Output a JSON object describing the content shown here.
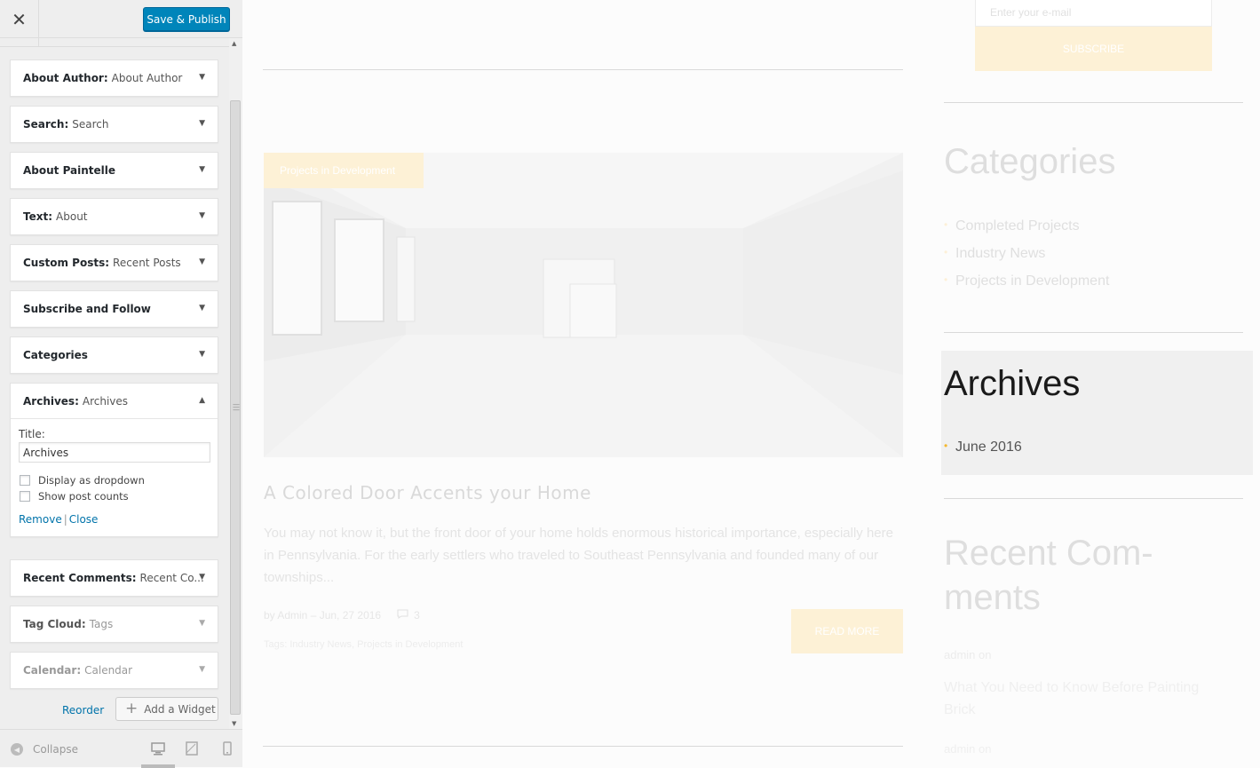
{
  "header": {
    "close_glyph": "✕",
    "save_publish_label": "Save & Publish"
  },
  "widgets": [
    {
      "name": "About Author",
      "sub": "About Author"
    },
    {
      "name": "Search",
      "sub": "Search"
    },
    {
      "name": "About Paintelle",
      "sub": ""
    },
    {
      "name": "Text",
      "sub": "About"
    },
    {
      "name": "Custom Posts",
      "sub": "Recent Posts"
    },
    {
      "name": "Subscribe and Follow",
      "sub": ""
    },
    {
      "name": "Categories",
      "sub": ""
    },
    {
      "name": "Archives",
      "sub": "Archives"
    },
    {
      "name": "Recent Comments",
      "sub": "Recent Co..."
    },
    {
      "name": "Tag Cloud",
      "sub": "Tags"
    },
    {
      "name": "Calendar",
      "sub": "Calendar"
    }
  ],
  "archives_form": {
    "title_label": "Title:",
    "title_value": "Archives",
    "dropdown_label": "Display as dropdown",
    "dropdown_checked": false,
    "post_counts_label": "Show post counts",
    "post_counts_checked": false,
    "remove_label": "Remove",
    "separator": "|",
    "close_label": "Close"
  },
  "sidebar_actions": {
    "reorder_label": "Reorder",
    "add_widget_label": "Add a Widget"
  },
  "footer": {
    "collapse_label": "Collapse",
    "active_device": "desktop"
  },
  "preview": {
    "post": {
      "category": "Projects in Development",
      "title": "A Colored Door Accents your Home",
      "excerpt": "You may not know it, but the front door of your home holds enormous historical importance, especially here in Pennsylvania. For the early settlers who traveled to Southeast Pennsylvania and founded many of our townships...",
      "meta": "by Admin – Jun, 27 2016",
      "comments": "3",
      "tags": "Tags: Industry News, Projects in Development",
      "read_more": "READ MORE"
    },
    "subscribe": {
      "email_placeholder": "Enter your e-mail",
      "button": "SUBSCRIBE"
    },
    "categories": {
      "title": "Categories",
      "items": [
        "Completed Projects",
        "Industry News",
        "Projects in Development"
      ]
    },
    "archives": {
      "title": "Archives",
      "items": [
        "June 2016"
      ]
    },
    "recent_comments": {
      "title": "Recent Com-ments",
      "author": "admin on",
      "link": "What You Need to Know Before Painting Brick",
      "author_2": "admin on"
    }
  },
  "colors": {
    "primary_button": "#0085ba",
    "link": "#0073aa",
    "accent_bullet": "#f5b82e",
    "accent_faded": "#fdf1d6"
  }
}
